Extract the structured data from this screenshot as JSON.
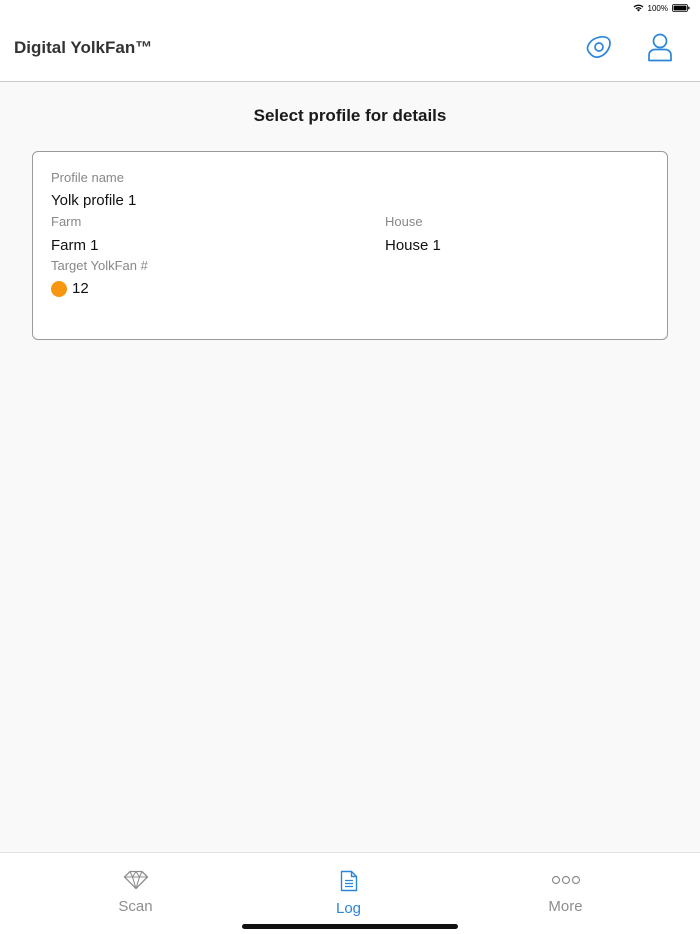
{
  "status_bar": {
    "battery_text": "100%"
  },
  "header": {
    "title": "Digital YolkFan™",
    "egg_icon": "egg-icon",
    "user_icon": "user-icon"
  },
  "main": {
    "title": "Select profile for details",
    "profile": {
      "profile_name_label": "Profile name",
      "profile_name": "Yolk profile 1",
      "farm_label": "Farm",
      "farm": "Farm 1",
      "house_label": "House",
      "house": "House 1",
      "target_label": "Target YolkFan #",
      "target_value": "12",
      "target_color": "#f7960f"
    }
  },
  "tabs": [
    {
      "label": "Scan",
      "icon": "diamond-icon",
      "active": false
    },
    {
      "label": "Log",
      "icon": "document-icon",
      "active": true
    },
    {
      "label": "More",
      "icon": "more-icon",
      "active": false
    }
  ],
  "colors": {
    "accent": "#2a86d8",
    "inactive": "#8e8e8e"
  }
}
